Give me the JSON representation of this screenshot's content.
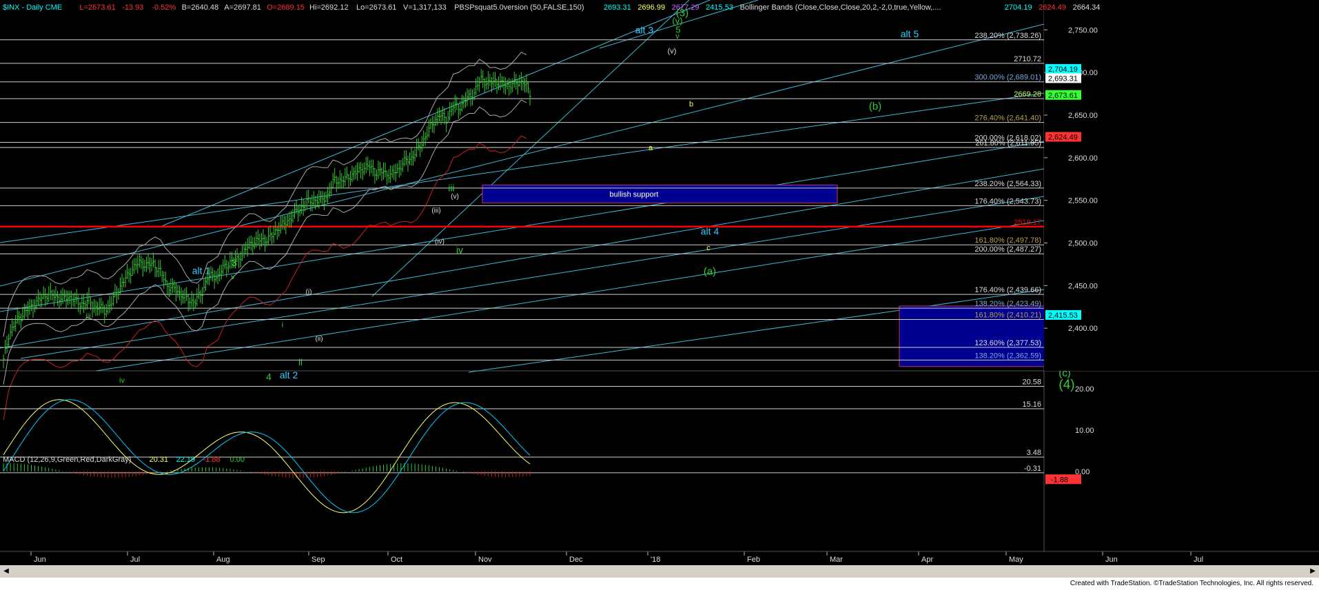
{
  "header": {
    "price_line": [
      {
        "text": "$INX - Daily  CME",
        "color": "#00ffff"
      },
      {
        "text": "L=2673.61",
        "color": "#ff3333"
      },
      {
        "text": "-13.93",
        "color": "#ff3333"
      },
      {
        "text": "-0.52%",
        "color": "#ff3333"
      },
      {
        "text": "B=2640.48",
        "color": "#dddddd"
      },
      {
        "text": "A=2697.81",
        "color": "#dddddd"
      },
      {
        "text": "O=2689.15",
        "color": "#ff3333"
      },
      {
        "text": "Hi=2692.12",
        "color": "#dddddd"
      },
      {
        "text": "Lo=2673.61",
        "color": "#dddddd"
      },
      {
        "text": "V=1,317,133",
        "color": "#dddddd"
      },
      {
        "text": "PBSPsquat5.0version (50,FALSE,150)",
        "color": "#dddddd"
      },
      {
        "text": "2693.31",
        "color": "#00ffff"
      },
      {
        "text": "2696.99",
        "color": "#ffff66"
      },
      {
        "text": "2677.29",
        "color": "#cc66ff"
      },
      {
        "text": "2415.53",
        "color": "#00ffff"
      },
      {
        "text": "Bollinger Bands (Close,Close,Close,20,2,-2,0,true,Yellow,....",
        "color": "#dddddd"
      },
      {
        "text": "2704.19",
        "color": "#00ffff"
      },
      {
        "text": "2624.49",
        "color": "#ff3333"
      },
      {
        "text": "2664.34",
        "color": "#dddddd"
      }
    ]
  },
  "macd_header": [
    {
      "text": "MACD (12,26,9,Green,Red,DarkGray)",
      "color": "#dddddd"
    },
    {
      "text": "20.31",
      "color": "#ffff66"
    },
    {
      "text": "22.19",
      "color": "#00ffff"
    },
    {
      "text": "-1.88",
      "color": "#ff3333"
    },
    {
      "text": "0.00",
      "color": "#33cc33"
    }
  ],
  "footer": {
    "credit": "Created with TradeStation. ©TradeStation Technologies, Inc. All rights reserved."
  },
  "chart_data": [
    {
      "type": "ohlc",
      "title": "$INX - Daily CME",
      "ylim": [
        2350,
        2785
      ],
      "x_ticks": [
        "Jun",
        "Jul",
        "Aug",
        "Sep",
        "Oct",
        "Nov",
        "Dec",
        "'18",
        "Feb",
        "Mar",
        "Apr",
        "May",
        "Jun",
        "Jul"
      ],
      "y_ticks": [
        2400,
        2450,
        2500,
        2550,
        2600,
        2650,
        2700,
        2750
      ],
      "price_path": [
        [
          0,
          2362
        ],
        [
          3,
          2392
        ],
        [
          8,
          2410
        ],
        [
          12,
          2418
        ],
        [
          16,
          2425
        ],
        [
          20,
          2432
        ],
        [
          25,
          2440
        ],
        [
          30,
          2437
        ],
        [
          34,
          2435
        ],
        [
          39,
          2436
        ],
        [
          44,
          2428
        ],
        [
          49,
          2432
        ],
        [
          52,
          2424
        ],
        [
          55,
          2425
        ],
        [
          58,
          2420
        ],
        [
          62,
          2430
        ],
        [
          66,
          2446
        ],
        [
          70,
          2458
        ],
        [
          74,
          2470
        ],
        [
          78,
          2477
        ],
        [
          82,
          2474
        ],
        [
          86,
          2476
        ],
        [
          90,
          2466
        ],
        [
          94,
          2450
        ],
        [
          98,
          2446
        ],
        [
          102,
          2440
        ],
        [
          106,
          2432
        ],
        [
          110,
          2432
        ],
        [
          114,
          2442
        ],
        [
          117,
          2460
        ],
        [
          120,
          2461
        ],
        [
          123,
          2461
        ],
        [
          126,
          2470
        ],
        [
          130,
          2478
        ],
        [
          134,
          2480
        ],
        [
          138,
          2490
        ],
        [
          142,
          2500
        ],
        [
          146,
          2503
        ],
        [
          150,
          2504
        ],
        [
          154,
          2508
        ],
        [
          158,
          2519
        ],
        [
          162,
          2523
        ],
        [
          166,
          2533
        ],
        [
          170,
          2540
        ],
        [
          174,
          2548
        ],
        [
          178,
          2550
        ],
        [
          182,
          2550
        ],
        [
          186,
          2556
        ],
        [
          190,
          2575
        ],
        [
          194,
          2572
        ],
        [
          198,
          2578
        ],
        [
          202,
          2582
        ],
        [
          206,
          2588
        ],
        [
          210,
          2590
        ],
        [
          214,
          2582
        ],
        [
          218,
          2584
        ],
        [
          222,
          2579
        ],
        [
          226,
          2586
        ],
        [
          230,
          2595
        ],
        [
          234,
          2600
        ],
        [
          238,
          2610
        ],
        [
          242,
          2625
        ],
        [
          246,
          2640
        ],
        [
          250,
          2650
        ],
        [
          254,
          2645
        ],
        [
          258,
          2660
        ],
        [
          262,
          2660
        ],
        [
          266,
          2670
        ],
        [
          270,
          2676
        ],
        [
          274,
          2693
        ],
        [
          278,
          2687
        ],
        [
          282,
          2690
        ],
        [
          286,
          2686
        ],
        [
          290,
          2685
        ],
        [
          294,
          2687
        ],
        [
          298,
          2690
        ],
        [
          302,
          2675
        ]
      ],
      "horizontal_levels": [
        {
          "label": "238.20% (2,738.26)",
          "value": 2738.26,
          "color": "#dddddd"
        },
        {
          "label": "2710.72",
          "value": 2710.72,
          "color": "#dddddd"
        },
        {
          "label": "300.00% (2,689.01)",
          "value": 2689.01,
          "color": "#7fa7d9"
        },
        {
          "label": "2669.28",
          "value": 2669.28,
          "color": "#ccff66"
        },
        {
          "label": "276.40% (2,641.40)",
          "value": 2641.4,
          "color": "#b8a050"
        },
        {
          "label": "200.00% (2,618.02)",
          "value": 2618.02,
          "color": "#dddddd"
        },
        {
          "label": "261.80% (2,611.95)",
          "value": 2611.95,
          "color": "#dddddd"
        },
        {
          "label": "238.20% (2,564.33)",
          "value": 2564.33,
          "color": "#dddddd"
        },
        {
          "label": "176.40% (2,543.73)",
          "value": 2543.73,
          "color": "#dddddd"
        },
        {
          "label": "2519.17",
          "value": 2519.17,
          "color": "#ff0000"
        },
        {
          "label": "161.80% (2,497.78)",
          "value": 2497.78,
          "color": "#b8a050"
        },
        {
          "label": "200.00% (2,487.27)",
          "value": 2487.27,
          "color": "#dddddd"
        },
        {
          "label": "176.40% (2,439.66)",
          "value": 2439.66,
          "color": "#dddddd"
        },
        {
          "label": "138.20% (2,423.49)",
          "value": 2423.49,
          "color": "#7fa7d9"
        },
        {
          "label": "161.80% (2,410.21)",
          "value": 2410.21,
          "color": "#b8a050"
        },
        {
          "label": "123.60% (2,377.53)",
          "value": 2377.53,
          "color": "#dddddd"
        },
        {
          "label": "138.20% (2,362.59)",
          "value": 2362.59,
          "color": "#7fa7d9"
        }
      ],
      "axis_badges": [
        {
          "label": "2,704.19",
          "value": 2704.19,
          "bg": "#00ffff",
          "fg": "#000000"
        },
        {
          "label": "2,693.31",
          "value": 2693.31,
          "bg": "#ffffff",
          "fg": "#000000"
        },
        {
          "label": "2,673.61",
          "value": 2673.61,
          "bg": "#33ff33",
          "fg": "#000000"
        },
        {
          "label": "2,624.49",
          "value": 2624.49,
          "bg": "#ff3333",
          "fg": "#000000"
        },
        {
          "label": "2,415.53",
          "value": 2415.53,
          "bg": "#00ffff",
          "fg": "#000000"
        }
      ],
      "zones": [
        {
          "label": "bullish support",
          "y_top": 2568,
          "y_bottom": 2547
        },
        {
          "label": "",
          "y_top": 2426,
          "y_bottom": 2355
        }
      ],
      "wave_labels": [
        {
          "text": "(3)",
          "color": "#33cc33",
          "size": 15
        },
        {
          "text": "(v)",
          "color": "#33cc33",
          "size": 13
        },
        {
          "text": "5",
          "color": "#33cc33",
          "size": 13
        },
        {
          "text": "v",
          "color": "#33cc33",
          "size": 11
        },
        {
          "text": "alt 3",
          "color": "#33ccff",
          "size": 14
        },
        {
          "text": "(v)",
          "color": "#dddddd",
          "size": 11
        },
        {
          "text": "alt 5",
          "color": "#33ccff",
          "size": 14
        },
        {
          "text": "(b)",
          "color": "#33cc33",
          "size": 15
        },
        {
          "text": "b",
          "color": "#ffff33",
          "size": 11
        },
        {
          "text": "a",
          "color": "#ffff33",
          "size": 11
        },
        {
          "text": "iii",
          "color": "#33cc33",
          "size": 14
        },
        {
          "text": "(v)",
          "color": "#dddddd",
          "size": 10
        },
        {
          "text": "(iii)",
          "color": "#dddddd",
          "size": 10
        },
        {
          "text": "(iv)",
          "color": "#dddddd",
          "size": 10
        },
        {
          "text": "iv",
          "color": "#33cc33",
          "size": 14
        },
        {
          "text": "alt 4",
          "color": "#33ccff",
          "size": 14
        },
        {
          "text": "c",
          "color": "#ffff33",
          "size": 11
        },
        {
          "text": "(a)",
          "color": "#33cc33",
          "size": 15
        },
        {
          "text": "alt 1",
          "color": "#33ccff",
          "size": 14
        },
        {
          "text": "3",
          "color": "#33cc33",
          "size": 14
        },
        {
          "text": "v",
          "color": "#33cc33",
          "size": 11
        },
        {
          "text": "iii",
          "color": "#33cc33",
          "size": 11
        },
        {
          "text": "(i)",
          "color": "#dddddd",
          "size": 10
        },
        {
          "text": "i",
          "color": "#33cc33",
          "size": 11
        },
        {
          "text": "(ii)",
          "color": "#dddddd",
          "size": 10
        },
        {
          "text": "ii",
          "color": "#33cc33",
          "size": 13
        },
        {
          "text": "iv",
          "color": "#33cc33",
          "size": 11
        },
        {
          "text": "4",
          "color": "#33cc33",
          "size": 14
        },
        {
          "text": "alt 2",
          "color": "#33ccff",
          "size": 14
        },
        {
          "text": "(c)",
          "color": "#33cc33",
          "size": 15
        },
        {
          "text": "(4)",
          "color": "#33cc33",
          "size": 19
        }
      ]
    },
    {
      "type": "macd",
      "title": "MACD (12,26,9,Green,Red,DarkGray)",
      "ylim": [
        -2,
        24
      ],
      "y_ticks": [
        20.0,
        10.0,
        0.0
      ],
      "levels": [
        {
          "label": "20.58",
          "value": 20.58
        },
        {
          "label": "15.16",
          "value": 15.16
        },
        {
          "label": "3.48",
          "value": 3.48
        },
        {
          "label": "-0.31",
          "value": -0.31
        }
      ],
      "badge": {
        "label": "-1.88",
        "value": -1.88
      }
    }
  ]
}
